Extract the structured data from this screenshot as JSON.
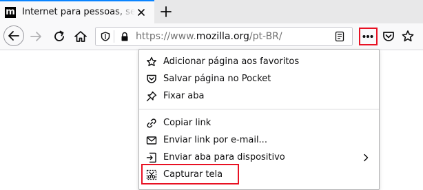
{
  "tab": {
    "favicon_letter": "m",
    "title": "Internet para pessoas, sem fins lucrativos"
  },
  "urlbar": {
    "prefix": "https://www.",
    "domain": "mozilla.org",
    "path": "/pt-BR/"
  },
  "menu": {
    "items": [
      {
        "label": "Adicionar página aos favoritos",
        "icon": "star-icon"
      },
      {
        "label": "Salvar página no Pocket",
        "icon": "pocket-icon"
      },
      {
        "label": "Fixar aba",
        "icon": "pin-icon"
      },
      {
        "label": "Copiar link",
        "icon": "link-icon"
      },
      {
        "label": "Enviar link por e-mail...",
        "icon": "mail-icon"
      },
      {
        "label": "Enviar aba para dispositivo",
        "icon": "send-to-device-icon"
      },
      {
        "label": "Capturar tela",
        "icon": "screenshot-icon"
      }
    ]
  },
  "colors": {
    "highlight": "#e81123",
    "tab_accent": "#0a84ff"
  }
}
